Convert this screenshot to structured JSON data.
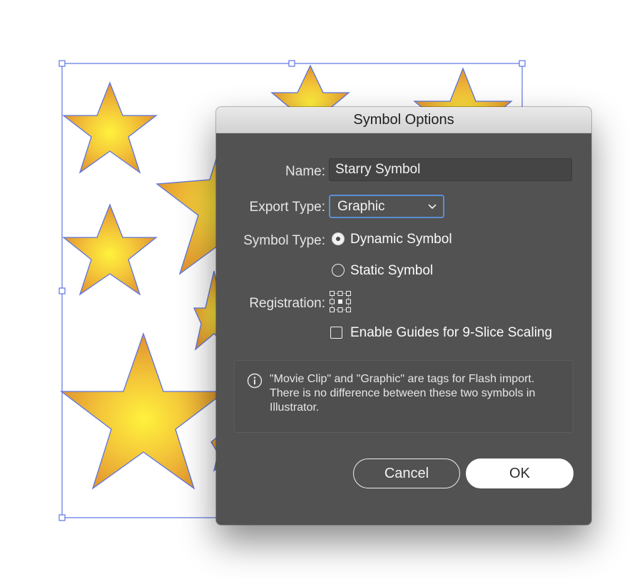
{
  "dialog": {
    "title": "Symbol Options",
    "name_label": "Name:",
    "name_value": "Starry Symbol",
    "export_type_label": "Export Type:",
    "export_type_value": "Graphic",
    "symbol_type_label": "Symbol Type:",
    "symbol_types": [
      {
        "label": "Dynamic Symbol",
        "selected": true
      },
      {
        "label": "Static Symbol",
        "selected": false
      }
    ],
    "registration_label": "Registration:",
    "nine_slice_label": "Enable Guides for 9-Slice Scaling",
    "nine_slice_checked": false,
    "info_text": "\"Movie Clip\" and \"Graphic\" are tags for Flash import. There is no difference between these two symbols in Illustrator.",
    "cancel_label": "Cancel",
    "ok_label": "OK"
  },
  "colors": {
    "dialog_bg": "#525252",
    "selection_blue": "#5b74e0",
    "star_center": "#fff23c",
    "star_edge": "#e0912e",
    "focus_ring": "#5b8fd6"
  },
  "icons": [
    "chevron-down-icon",
    "info-icon",
    "registration-grid-icon",
    "star-shape"
  ]
}
